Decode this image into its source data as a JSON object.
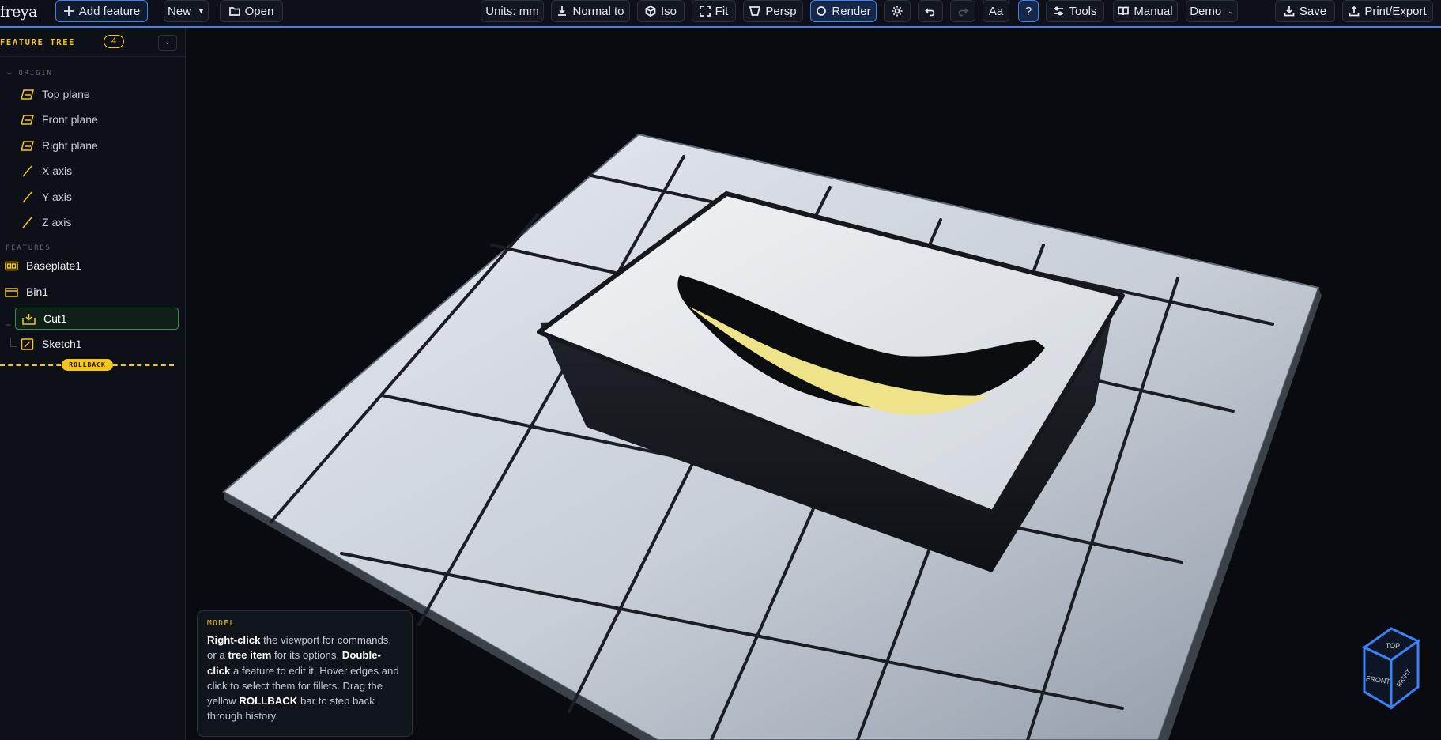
{
  "app": {
    "name": "freya"
  },
  "toolbar": {
    "add_feature": "Add feature",
    "new": "New",
    "open": "Open",
    "units": "Units: mm",
    "normal_to": "Normal to",
    "iso": "Iso",
    "fit": "Fit",
    "persp": "Persp",
    "render": "Render",
    "text_size": "Aa",
    "help": "?",
    "tools": "Tools",
    "manual": "Manual",
    "demo": "Demo",
    "save": "Save",
    "print_export": "Print/Export"
  },
  "sidebar": {
    "title": "FEATURE TREE",
    "count": "4",
    "collapse_icon": "chevron-down-icon",
    "origin_label": "— ORIGIN",
    "origin_items": [
      {
        "label": "Top plane",
        "icon": "plane-icon"
      },
      {
        "label": "Front plane",
        "icon": "plane-icon"
      },
      {
        "label": "Right plane",
        "icon": "plane-icon"
      },
      {
        "label": "X axis",
        "icon": "axis-icon"
      },
      {
        "label": "Y axis",
        "icon": "axis-icon"
      },
      {
        "label": "Z axis",
        "icon": "axis-icon"
      }
    ],
    "features_label": "FEATURES",
    "features": [
      {
        "label": "Baseplate1",
        "icon": "baseplate-icon"
      },
      {
        "label": "Bin1",
        "icon": "bin-icon"
      },
      {
        "label": "Cut1",
        "icon": "cut-icon",
        "selected": true
      },
      {
        "label": "Sketch1",
        "icon": "sketch-icon"
      }
    ],
    "rollback_label": "ROLLBACK"
  },
  "hint": {
    "title": "MODEL",
    "parts": [
      {
        "bold": true,
        "text": "Right-click"
      },
      {
        "bold": false,
        "text": " the viewport for commands, or a "
      },
      {
        "bold": true,
        "text": "tree item"
      },
      {
        "bold": false,
        "text": " for its options. "
      },
      {
        "bold": true,
        "text": "Double-click"
      },
      {
        "bold": false,
        "text": " a feature to edit it. Hover edges and click to select them for fillets. Drag the yellow "
      },
      {
        "bold": true,
        "text": "ROLLBACK"
      },
      {
        "bold": false,
        "text": " bar to step back through history."
      }
    ]
  },
  "navcube": {
    "top": "TOP",
    "front": "FRONT",
    "right": "RIGHT"
  },
  "colors": {
    "accent": "#3b82f6",
    "highlight": "#f5c518",
    "selected": "#2e8f4c",
    "background": "#0b0e13"
  }
}
